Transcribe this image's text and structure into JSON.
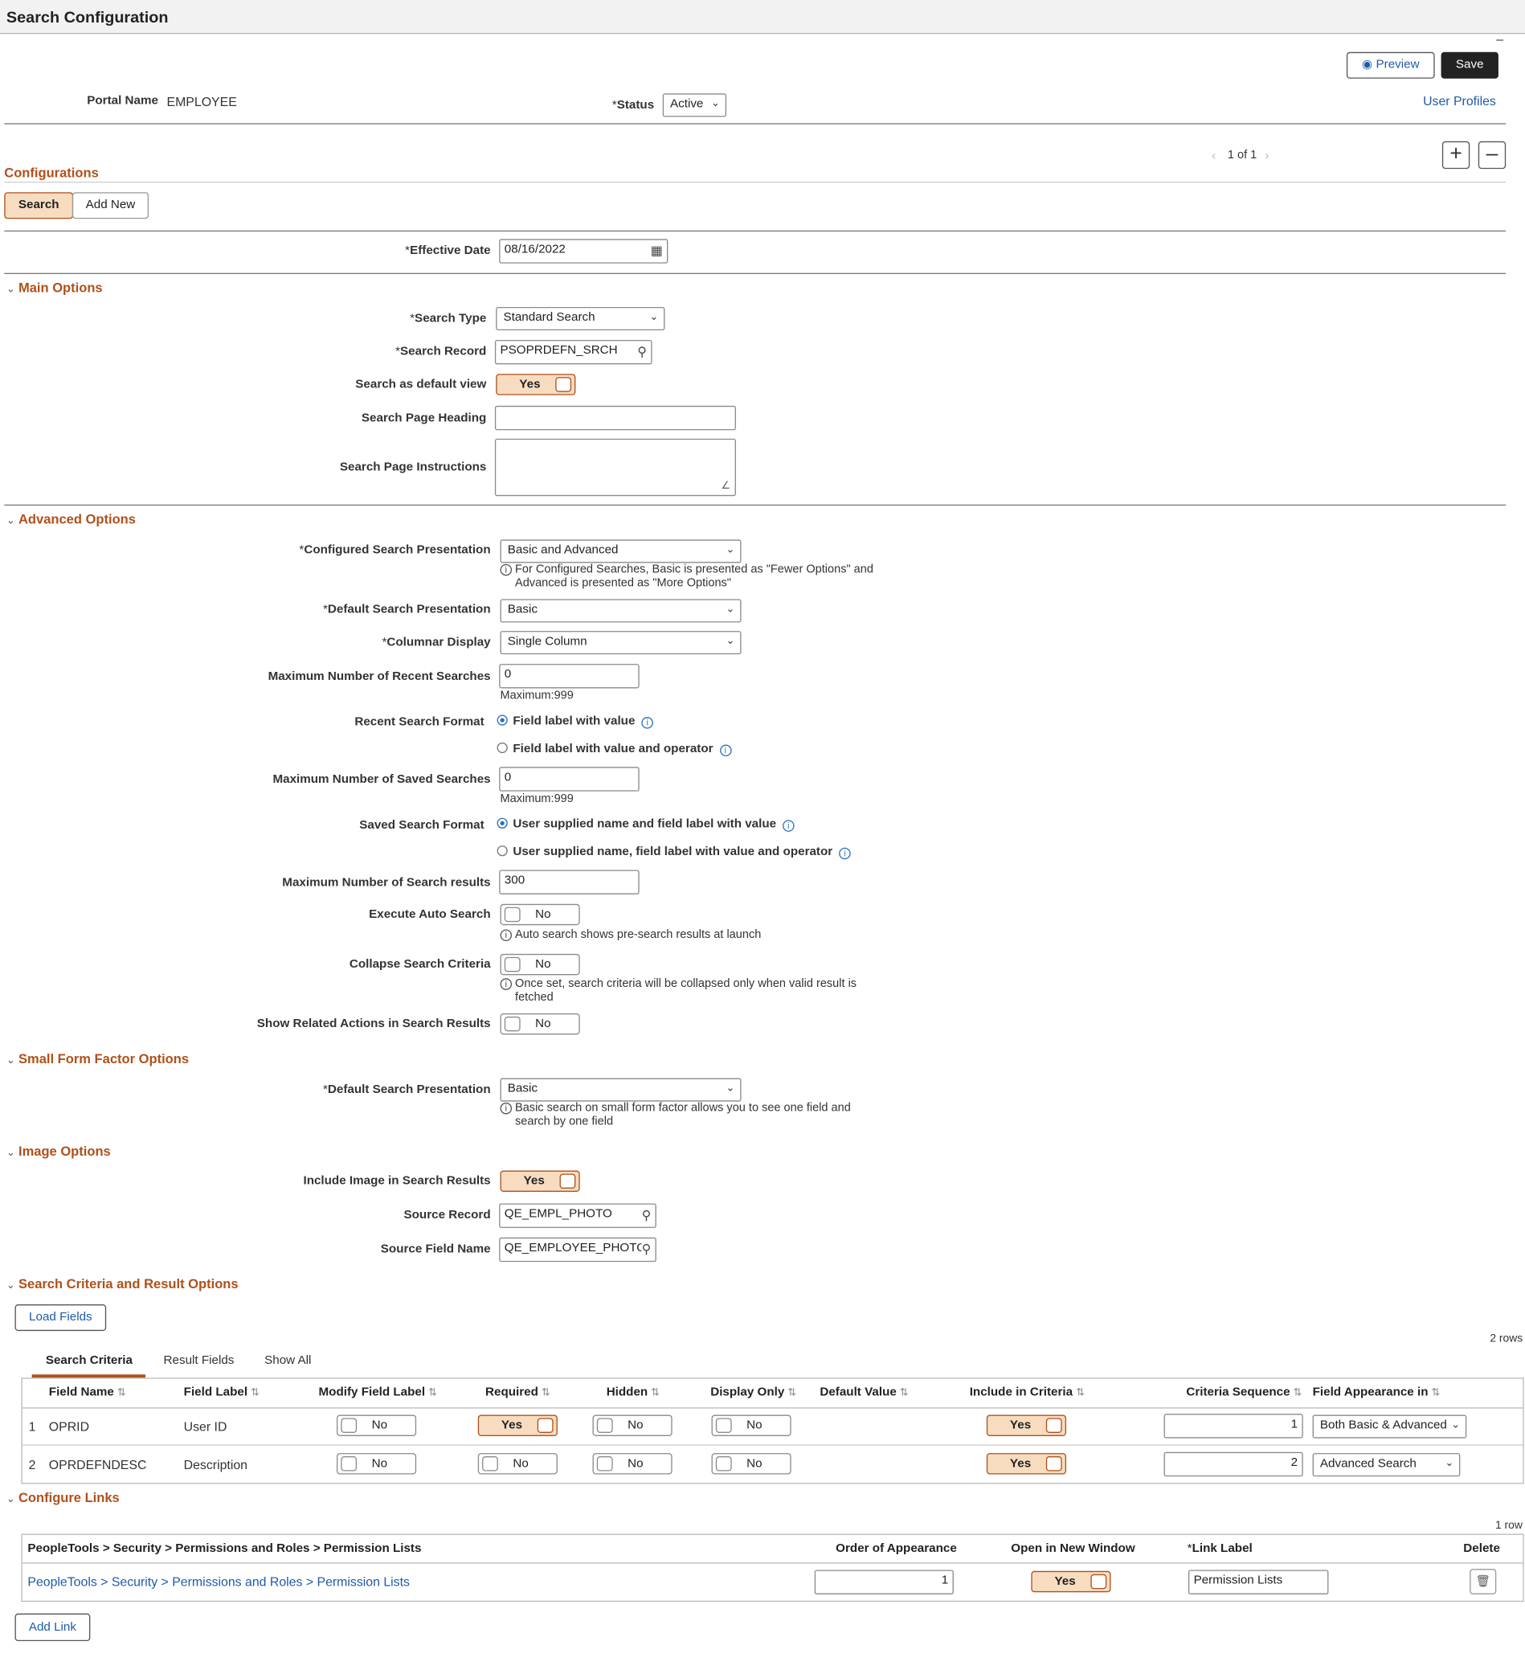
{
  "page": {
    "title": "Search Configuration",
    "collapse_glyph": "–"
  },
  "header": {
    "preview_label": "Preview",
    "save_label": "Save",
    "portal_label": "Portal Name",
    "portal_value": "EMPLOYEE",
    "status_label": "Status",
    "status_value": "Active",
    "user_profiles": "User Profiles"
  },
  "config": {
    "title": "Configurations",
    "pager": "1 of 1",
    "search_btn": "Search",
    "addnew_btn": "Add New",
    "eff_date_label": "Effective Date",
    "eff_date_value": "08/16/2022"
  },
  "main": {
    "title": "Main Options",
    "search_type_label": "Search Type",
    "search_type": "Standard Search",
    "search_record_label": "Search Record",
    "search_record": "PSOPRDEFN_SRCH",
    "default_view_label": "Search as default view",
    "default_view": "Yes",
    "heading_label": "Search Page Heading",
    "heading_value": "",
    "instructions_label": "Search Page Instructions",
    "instructions_value": ""
  },
  "advanced": {
    "title": "Advanced Options",
    "presentation_label": "Configured Search Presentation",
    "presentation": "Basic and Advanced",
    "presentation_help_1": "For Configured Searches, Basic is presented as \"Fewer Options\" and",
    "presentation_help_2": "Advanced is presented as \"More Options\"",
    "default_pres_label": "Default Search Presentation",
    "default_pres": "Basic",
    "columnar_label": "Columnar Display",
    "columnar": "Single Column",
    "max_recent_label": "Maximum Number of Recent Searches",
    "max_recent": "0",
    "max_recent_hint": "Maximum:999",
    "recent_format_label": "Recent Search Format",
    "recent_opt1": "Field label with value",
    "recent_opt2": "Field label with value and operator",
    "max_saved_label": "Maximum Number of Saved Searches",
    "max_saved": "0",
    "max_saved_hint": "Maximum:999",
    "saved_format_label": "Saved Search Format",
    "saved_opt1": "User supplied name and field label with value",
    "saved_opt2": "User supplied name, field label with value and operator",
    "max_results_label": "Maximum Number of Search results",
    "max_results": "300",
    "auto_label": "Execute Auto Search",
    "auto": "No",
    "auto_help": "Auto search shows pre-search results at launch",
    "collapse_label": "Collapse Search Criteria",
    "collapse": "No",
    "collapse_help_1": "Once set, search criteria will be collapsed only when valid result is",
    "collapse_help_2": "fetched",
    "related_label": "Show Related Actions in Search Results",
    "related": "No"
  },
  "small": {
    "title": "Small Form Factor Options",
    "default_pres_label": "Default Search Presentation",
    "default_pres": "Basic",
    "help_1": "Basic search on small form factor allows you to see one field and",
    "help_2": "search by one field"
  },
  "image": {
    "title": "Image Options",
    "include_label": "Include Image in Search Results",
    "include": "Yes",
    "src_record_label": "Source Record",
    "src_record": "QE_EMPL_PHOTO",
    "src_field_label": "Source Field Name",
    "src_field": "QE_EMPLOYEE_PHOTO"
  },
  "criteria": {
    "title": "Search Criteria and Result Options",
    "load_btn": "Load Fields",
    "rows": "2 rows",
    "tabs": [
      "Search Criteria",
      "Result Fields",
      "Show All"
    ],
    "columns": [
      "Field Name",
      "Field Label",
      "Modify Field Label",
      "Required",
      "Hidden",
      "Display Only",
      "Default Value",
      "Include in Criteria",
      "Criteria Sequence",
      "Field Appearance in"
    ],
    "data": [
      {
        "n": "1",
        "field": "OPRID",
        "label": "User ID",
        "modify": "No",
        "required": "Yes",
        "hidden": "No",
        "display_only": "No",
        "include": "Yes",
        "seq": "1",
        "appearance": "Both Basic & Advanced"
      },
      {
        "n": "2",
        "field": "OPRDEFNDESC",
        "label": "Description",
        "modify": "No",
        "required": "No",
        "hidden": "No",
        "display_only": "No",
        "include": "Yes",
        "seq": "2",
        "appearance": "Advanced Search"
      }
    ]
  },
  "links": {
    "title": "Configure Links",
    "rows": "1 row",
    "columns": [
      "PeopleTools > Security > Permissions and Roles > Permission Lists",
      "Order of Appearance",
      "Open in New Window",
      "Link Label",
      "Delete"
    ],
    "data": [
      {
        "path": "PeopleTools > Security > Permissions and Roles > Permission Lists",
        "order": "1",
        "new_window": "Yes",
        "label": "Permission Lists"
      }
    ],
    "add_btn": "Add Link"
  }
}
